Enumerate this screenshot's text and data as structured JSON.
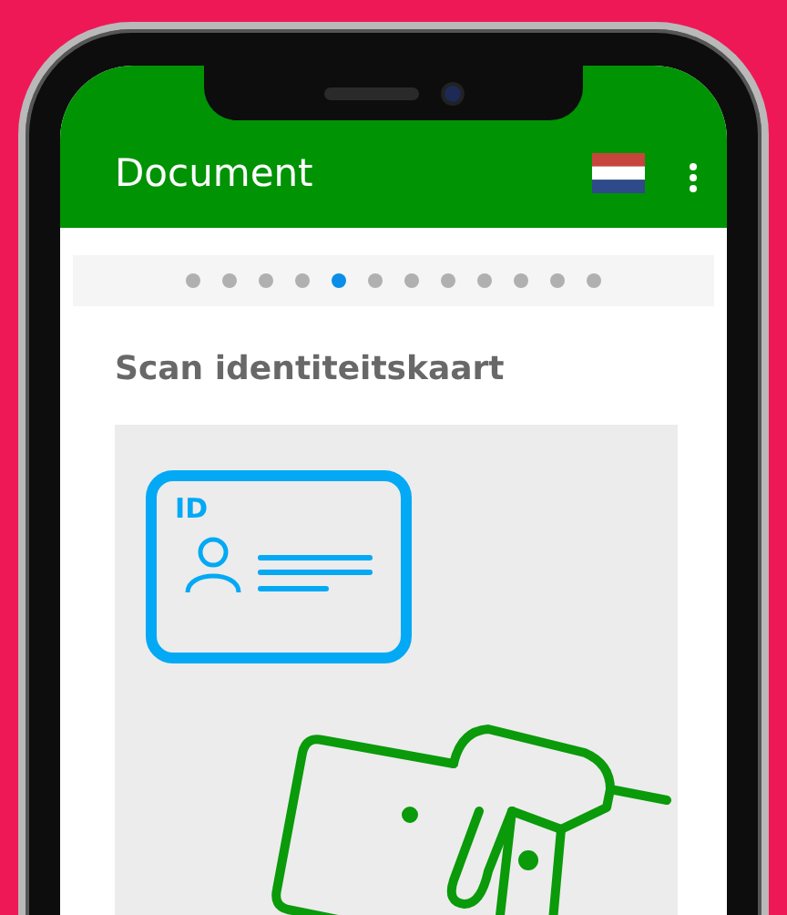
{
  "app_bar": {
    "title": "Document"
  },
  "pager": {
    "dots": [
      {
        "selected": false
      },
      {
        "selected": false
      },
      {
        "selected": false
      },
      {
        "selected": false
      },
      {
        "selected": true
      },
      {
        "selected": false
      },
      {
        "selected": false
      },
      {
        "selected": false
      },
      {
        "selected": false
      },
      {
        "selected": false
      },
      {
        "selected": false
      },
      {
        "selected": false
      }
    ]
  },
  "heading": "Scan identiteitskaart",
  "illustration": {
    "card_label": "ID"
  }
}
